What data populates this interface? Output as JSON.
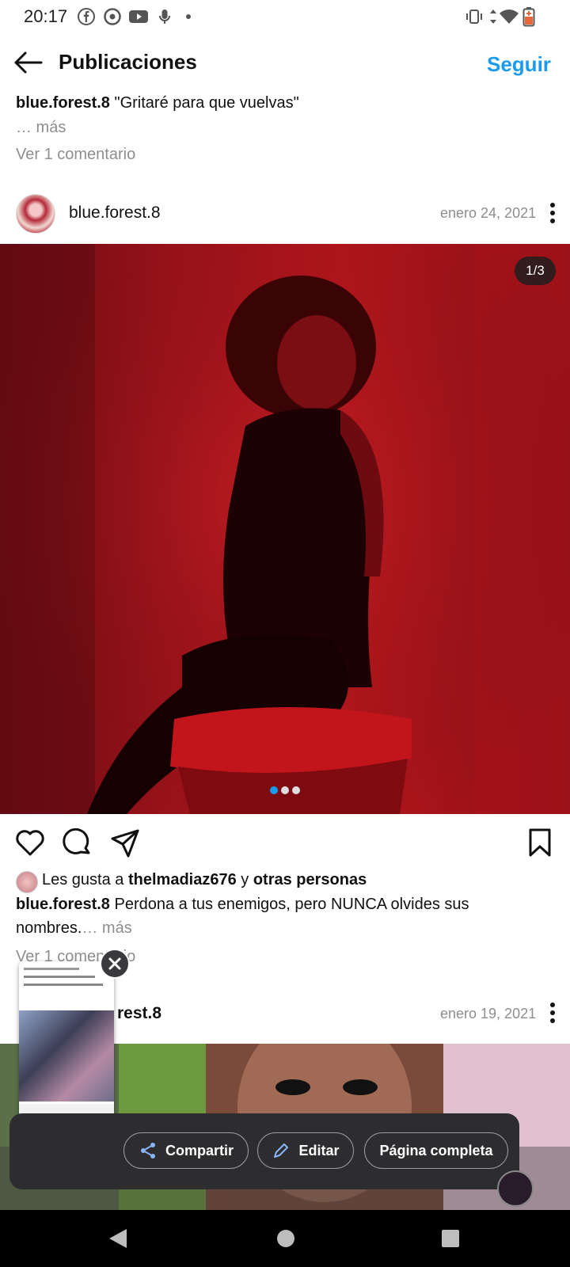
{
  "status_bar": {
    "time": "20:17"
  },
  "header": {
    "title": "Publicaciones",
    "follow_label": "Seguir"
  },
  "prev_post": {
    "username": "blue.forest.8",
    "caption": "\"Gritaré para que vuelvas\"",
    "more": "… más",
    "view_comments": "Ver 1 comentario"
  },
  "post": {
    "username": "blue.forest.8",
    "date": "enero 24, 2021",
    "counter": "1/3",
    "likes_prefix": "Les gusta a",
    "likes_user": "thelmadiaz676",
    "likes_joiner": "y",
    "likes_suffix": "otras personas",
    "caption_user": "blue.forest.8",
    "caption_line1": "Perdona a tus enemigos, pero NUNCA olvides sus",
    "caption_line2": "nombres.",
    "more": "… más",
    "view_comments": "Ver 1 comentario"
  },
  "next_post": {
    "username_partial": "rest.8",
    "date": "enero 19, 2021"
  },
  "screenshot_actions": {
    "share": "Compartir",
    "edit": "Editar",
    "full_page": "Página completa"
  },
  "colors": {
    "accent": "#1a9bf0",
    "overlay": "#2d2d30"
  }
}
